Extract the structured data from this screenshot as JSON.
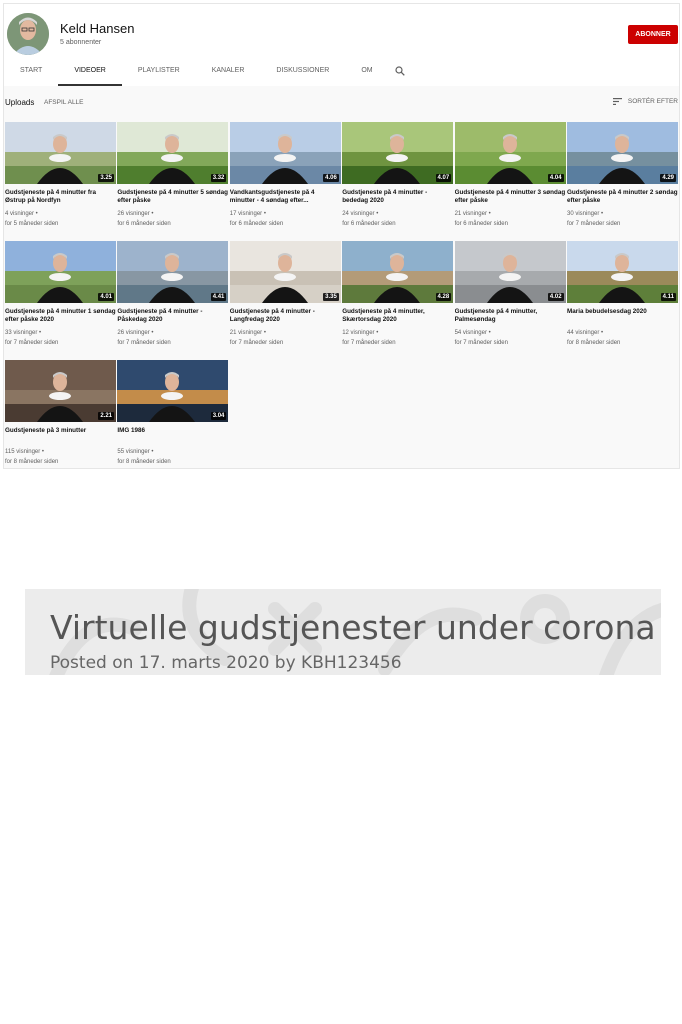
{
  "channel": {
    "name": "Keld Hansen",
    "subscribers": "5 abonnenter",
    "subscribe_label": "ABONNER"
  },
  "tabs": [
    {
      "label": "START"
    },
    {
      "label": "VIDEOER"
    },
    {
      "label": "PLAYLISTER"
    },
    {
      "label": "KANALER"
    },
    {
      "label": "DISKUSSIONER"
    },
    {
      "label": "OM"
    }
  ],
  "uploads": {
    "title": "Uploads",
    "play_all": "AFSPIL ALLE",
    "sort": "SORTÉR EFTER"
  },
  "videos": [
    {
      "title": "Gudstjeneste på 4 minutter fra Østrup på Nordfyn",
      "views": "4 visninger",
      "age": "for 5 måneder siden",
      "duration": "3.25",
      "scene": "field"
    },
    {
      "title": "Gudstjeneste på 4 minutter 5 søndag efter påske",
      "views": "26 visninger",
      "age": "for 6 måneder siden",
      "duration": "3.32",
      "scene": "garden"
    },
    {
      "title": "Vandkantsgudstjeneste på 4 minutter - 4 søndag efter...",
      "views": "17 visninger",
      "age": "for 6 måneder siden",
      "duration": "4.06",
      "scene": "sea"
    },
    {
      "title": "Gudstjeneste på 4 minutter - bededag 2020",
      "views": "24 visninger",
      "age": "for 6 måneder siden",
      "duration": "4.07",
      "scene": "forest"
    },
    {
      "title": "Gudstjeneste på 4 minutter 3 søndag efter påske",
      "views": "21 visninger",
      "age": "for 6 måneder siden",
      "duration": "4.04",
      "scene": "meadow"
    },
    {
      "title": "Gudstjeneste på 4 minutter 2 søndag efter påske",
      "views": "30 visninger",
      "age": "for 7 måneder siden",
      "duration": "4.29",
      "scene": "shore"
    },
    {
      "title": "Gudstjeneste på 4 minutter 1 søndag efter påske 2020",
      "views": "33 visninger",
      "age": "for 7 måneder siden",
      "duration": "4.01",
      "scene": "road"
    },
    {
      "title": "Gudstjeneste på 4 minutter - Påskedag 2020",
      "views": "26 visninger",
      "age": "for 7 måneder siden",
      "duration": "4.41",
      "scene": "harbor"
    },
    {
      "title": "Gudstjeneste på 4 minutter - Langfredag 2020",
      "views": "21 visninger",
      "age": "for 7 måneder siden",
      "duration": "3.35",
      "scene": "church"
    },
    {
      "title": "Gudstjeneste på 4 minutter, Skærtorsdag 2020",
      "views": "12 visninger",
      "age": "for 7 måneder siden",
      "duration": "4.28",
      "scene": "house"
    },
    {
      "title": "Gudstjeneste på 4 minutter, Palmesøndag",
      "views": "54 visninger",
      "age": "for 7 måneder siden",
      "duration": "4.02",
      "scene": "grey"
    },
    {
      "title": "Maria bebudelsesdag 2020",
      "views": "44 visninger",
      "age": "for 8 måneder siden",
      "duration": "4.11",
      "scene": "sunset"
    },
    {
      "title": "Gudstjeneste på 3 minutter",
      "views": "115 visninger",
      "age": "for 8 måneder siden",
      "duration": "2.21",
      "scene": "indoor"
    },
    {
      "title": "IMG 1986",
      "views": "55 visninger",
      "age": "for 8 måneder siden",
      "duration": "3.04",
      "scene": "dark"
    }
  ],
  "post": {
    "title": "Virtuelle gudstjenester under corona",
    "meta": "Posted on 17. marts 2020 by KBH123456"
  },
  "colors": {
    "subscribe": "#cc0000",
    "banner": "#ececec"
  }
}
